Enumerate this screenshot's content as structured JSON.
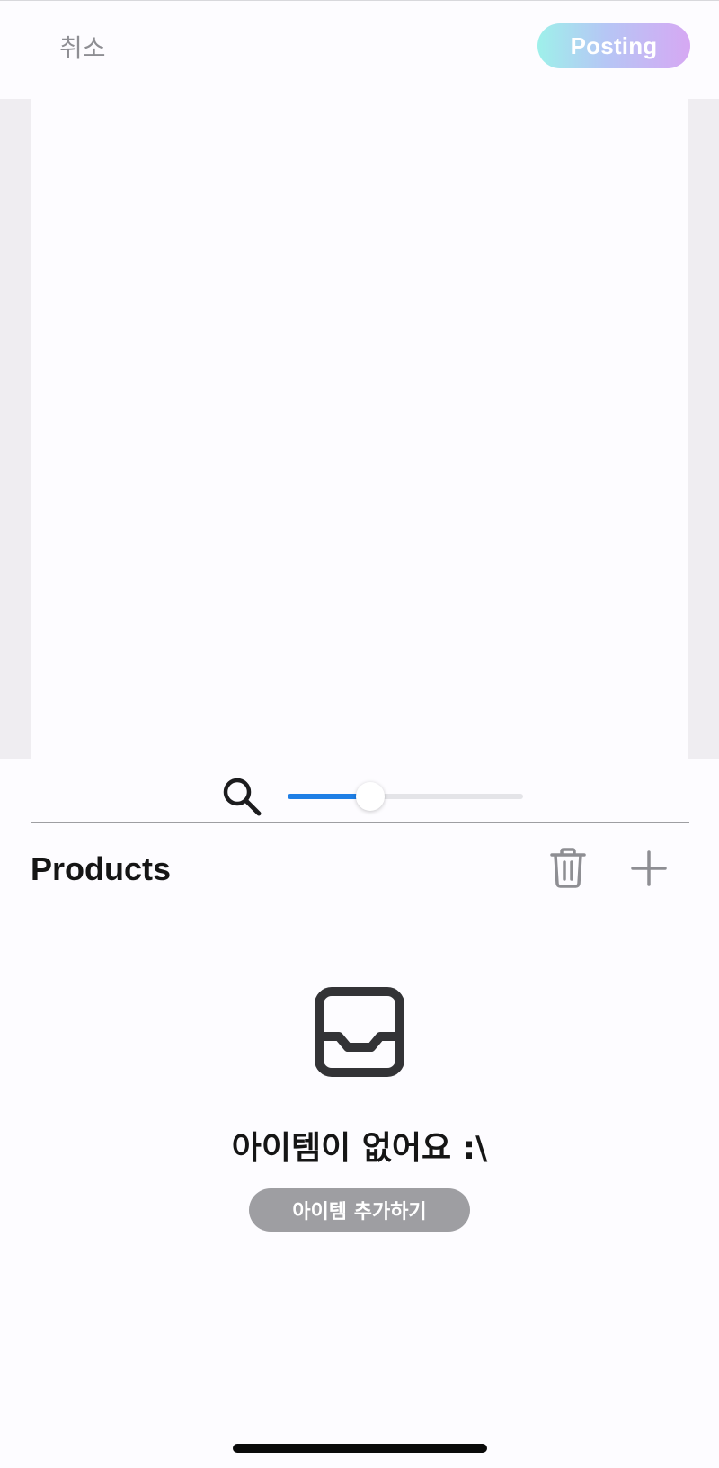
{
  "header": {
    "cancel_label": "취소",
    "posting_label": "Posting"
  },
  "zoom": {
    "icon": "search-icon",
    "level": 0.35
  },
  "products": {
    "title": "Products",
    "delete_icon": "trash-icon",
    "add_icon": "plus-icon"
  },
  "empty_state": {
    "icon": "inbox-icon",
    "title": "아이템이 없어요 :\\",
    "add_button_label": "아이템 추가하기"
  },
  "colors": {
    "accent_blue": "#1f7fe6",
    "posting_gradient": [
      "#9ef0ea",
      "#b6c6f5",
      "#d6a8f3"
    ],
    "muted_gray": "#9e9ea2",
    "text_dark": "#151515"
  }
}
